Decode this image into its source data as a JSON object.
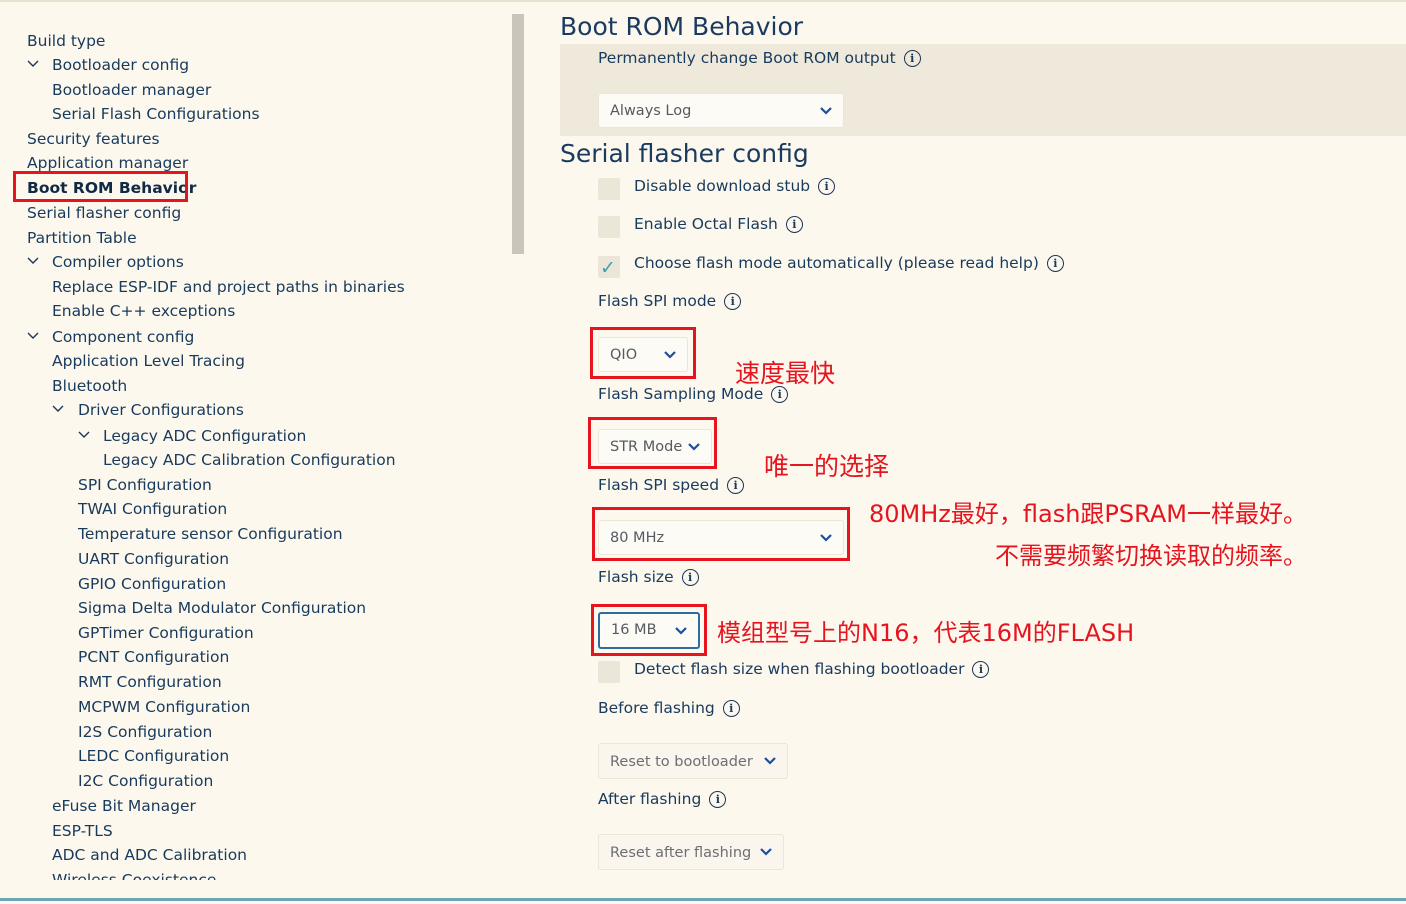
{
  "sidebar": {
    "items": [
      {
        "label": "Build type"
      },
      {
        "label": "Bootloader config"
      },
      {
        "label": "Bootloader manager"
      },
      {
        "label": "Serial Flash Configurations"
      },
      {
        "label": "Security features"
      },
      {
        "label": "Application manager"
      },
      {
        "label": "Boot ROM Behavior"
      },
      {
        "label": "Serial flasher config"
      },
      {
        "label": "Partition Table"
      },
      {
        "label": "Compiler options"
      },
      {
        "label": "Replace ESP-IDF and project paths in binaries"
      },
      {
        "label": "Enable C++ exceptions"
      },
      {
        "label": "Component config"
      },
      {
        "label": "Application Level Tracing"
      },
      {
        "label": "Bluetooth"
      },
      {
        "label": "Driver Configurations"
      },
      {
        "label": "Legacy ADC Configuration"
      },
      {
        "label": "Legacy ADC Calibration Configuration"
      },
      {
        "label": "SPI Configuration"
      },
      {
        "label": "TWAI Configuration"
      },
      {
        "label": "Temperature sensor Configuration"
      },
      {
        "label": "UART Configuration"
      },
      {
        "label": "GPIO Configuration"
      },
      {
        "label": "Sigma Delta Modulator Configuration"
      },
      {
        "label": "GPTimer Configuration"
      },
      {
        "label": "PCNT Configuration"
      },
      {
        "label": "RMT Configuration"
      },
      {
        "label": "MCPWM Configuration"
      },
      {
        "label": "I2S Configuration"
      },
      {
        "label": "LEDC Configuration"
      },
      {
        "label": "I2C Configuration"
      },
      {
        "label": "eFuse Bit Manager"
      },
      {
        "label": "ESP-TLS"
      },
      {
        "label": "ADC and ADC Calibration"
      },
      {
        "label": "Wireless Coexistence"
      }
    ]
  },
  "boot_rom": {
    "title": "Boot ROM Behavior",
    "output_label": "Permanently change Boot ROM output",
    "output_value": "Always Log"
  },
  "flasher": {
    "title": "Serial flasher config",
    "disable_stub_label": "Disable download stub",
    "disable_stub_checked": false,
    "octal_label": "Enable Octal Flash",
    "octal_checked": false,
    "auto_mode_label": "Choose flash mode automatically (please read help)",
    "auto_mode_checked": true,
    "spi_mode_label": "Flash SPI mode",
    "spi_mode_value": "QIO",
    "sampling_label": "Flash Sampling Mode",
    "sampling_value": "STR Mode",
    "speed_label": "Flash SPI speed",
    "speed_value": "80 MHz",
    "size_label": "Flash size",
    "size_value": "16 MB",
    "detect_label": "Detect flash size when flashing bootloader",
    "detect_checked": false,
    "before_label": "Before flashing",
    "before_value": "Reset to bootloader",
    "after_label": "After flashing",
    "after_value": "Reset after flashing"
  },
  "annotations": {
    "qio_note": "速度最快",
    "str_note": "唯一的选择",
    "speed_note_1": "80MHz最好，flash跟PSRAM一样最好。",
    "speed_note_2": "不需要频繁切换读取的频率。",
    "size_note": "模组型号上的N16，代表16M的FLASH"
  },
  "icons": {
    "info": "i",
    "check": "✓"
  },
  "colors": {
    "annotation_red": "#e5141e",
    "text_navy": "#1d3557",
    "background": "#fcf8ee",
    "check_teal": "#3aa0a6"
  }
}
